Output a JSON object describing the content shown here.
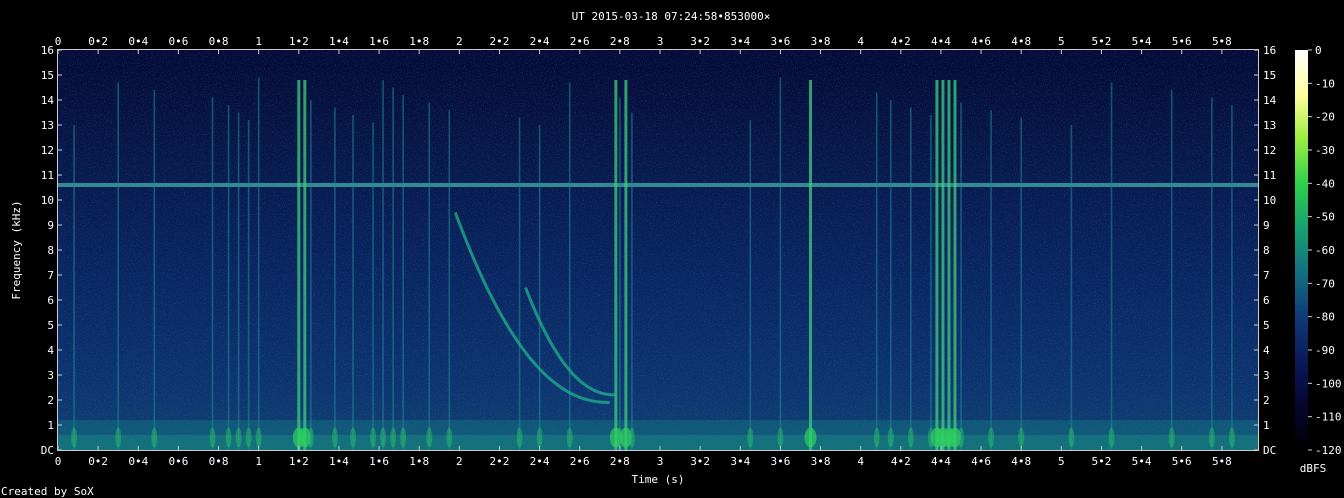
{
  "chart_data": {
    "type": "heatmap",
    "title": "UT 2015-03-18 07:24:58•853000×",
    "xlabel": "Time (s)",
    "ylabel": "Frequency (kHz)",
    "colorbar_label": "dBFS",
    "footer": "Created by SoX",
    "xlim": [
      0,
      5.98
    ],
    "ylim": [
      0,
      16
    ],
    "x_ticks": [
      "0",
      "0•2",
      "0•4",
      "0•6",
      "0•8",
      "1",
      "1•2",
      "1•4",
      "1•6",
      "1•8",
      "2",
      "2•2",
      "2•4",
      "2•6",
      "2•8",
      "3",
      "3•2",
      "3•4",
      "3•6",
      "3•8",
      "4",
      "4•2",
      "4•4",
      "4•6",
      "4•8",
      "5",
      "5•2",
      "5•4",
      "5•6",
      "5•8"
    ],
    "y_ticks": [
      "DC",
      "1",
      "2",
      "3",
      "4",
      "5",
      "6",
      "7",
      "8",
      "9",
      "10",
      "11",
      "12",
      "13",
      "14",
      "15",
      "16"
    ],
    "colorbar_ticks": [
      "0",
      "-10",
      "-20",
      "-30",
      "-40",
      "-50",
      "-60",
      "-70",
      "-80",
      "-90",
      "-100",
      "-110",
      "-120"
    ],
    "colorbar_range": [
      -120,
      0
    ],
    "colormap": [
      "#000000",
      "#06062e",
      "#0a1a5a",
      "#0f3a7a",
      "#137080",
      "#18a070",
      "#2ed04a",
      "#9aee40",
      "#ffffa0",
      "#ffffff"
    ],
    "features": {
      "steady_tone_khz": 10.6,
      "impulses_s": [
        0.08,
        0.3,
        0.48,
        0.77,
        0.85,
        0.9,
        0.95,
        1.0,
        1.2,
        1.23,
        1.26,
        1.38,
        1.47,
        1.57,
        1.62,
        1.67,
        1.72,
        1.85,
        1.95,
        2.3,
        2.4,
        2.55,
        2.78,
        2.8,
        2.83,
        2.86,
        3.45,
        3.6,
        3.75,
        4.08,
        4.15,
        4.25,
        4.35,
        4.38,
        4.41,
        4.44,
        4.47,
        4.5,
        4.65,
        4.8,
        5.05,
        5.25,
        5.55,
        5.75,
        5.85
      ],
      "strong_impulses_s": [
        1.2,
        1.23,
        2.78,
        2.83,
        3.75,
        4.1,
        4.38,
        4.41,
        4.44,
        4.47
      ],
      "whistlers": [
        {
          "start_s": 1.98,
          "end_s": 2.75,
          "f_high_khz": 9.5,
          "f_low_khz": 1.9
        },
        {
          "start_s": 2.33,
          "end_s": 2.78,
          "f_high_khz": 6.5,
          "f_low_khz": 2.2
        }
      ]
    }
  }
}
